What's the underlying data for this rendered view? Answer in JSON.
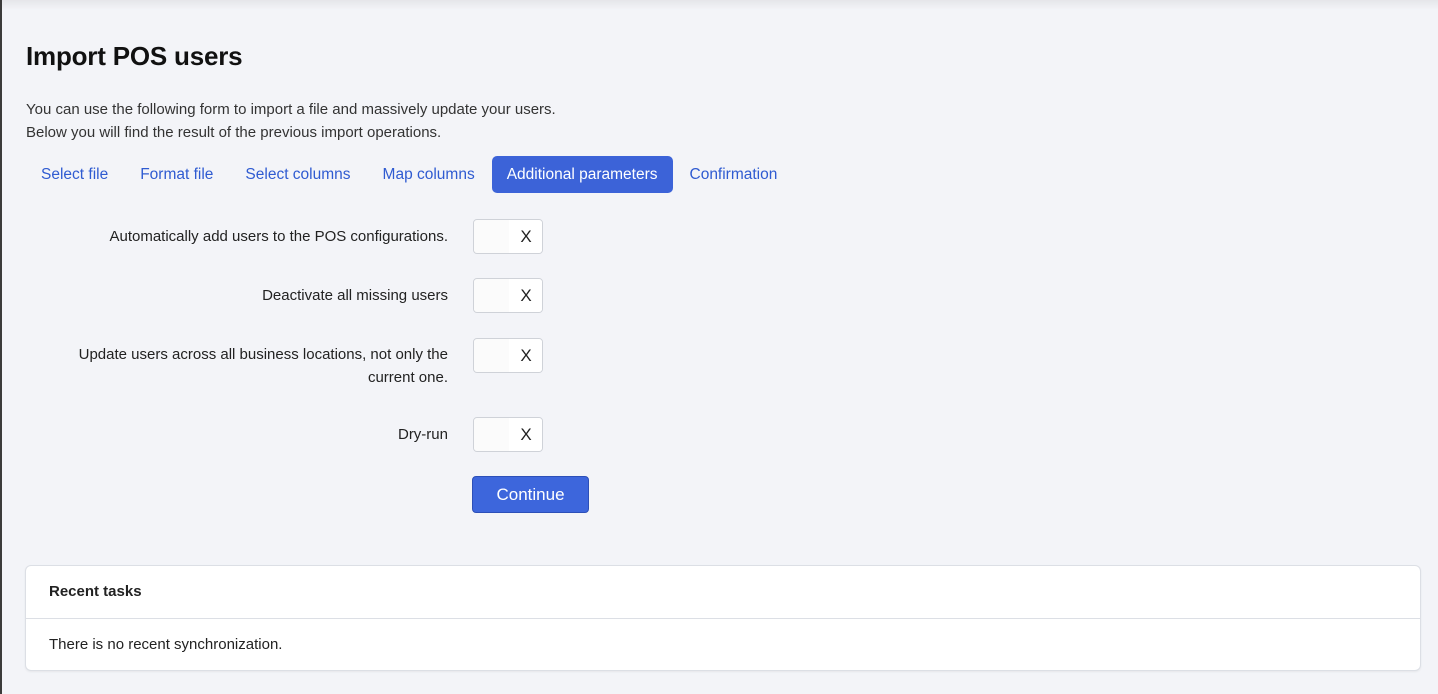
{
  "page": {
    "title": "Import POS users",
    "intro_line1": "You can use the following form to import a file and massively update your users.",
    "intro_line2": "Below you will find the result of the previous import operations."
  },
  "steps": [
    {
      "label": "Select file",
      "active": false
    },
    {
      "label": "Format file",
      "active": false
    },
    {
      "label": "Select columns",
      "active": false
    },
    {
      "label": "Map columns",
      "active": false
    },
    {
      "label": "Additional parameters",
      "active": true
    },
    {
      "label": "Confirmation",
      "active": false
    }
  ],
  "options": [
    {
      "label": "Automatically add users to the POS configurations.",
      "state_text": "X",
      "enabled": false
    },
    {
      "label": "Deactivate all missing users",
      "state_text": "X",
      "enabled": false
    },
    {
      "label_line1": "Update users across all business locations, not only the",
      "label_line2": "current one.",
      "state_text": "X",
      "enabled": false
    },
    {
      "label": "Dry-run",
      "state_text": "X",
      "enabled": false
    }
  ],
  "continue_label": "Continue",
  "recent_tasks": {
    "title": "Recent tasks",
    "empty_message": "There is no recent synchronization."
  },
  "colors": {
    "accent": "#3c63d8",
    "link": "#2f5bd1",
    "background": "#f3f4f8"
  }
}
